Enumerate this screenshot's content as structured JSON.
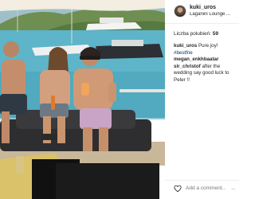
{
  "post": {
    "username": "kuki_uros",
    "location": "Laganini Lounge ...",
    "likes_label": "Liczba polubień:",
    "likes_count": "59",
    "comments": [
      {
        "author": "kuki_uros",
        "text": "Pure joy!",
        "tag": "#bestfrie"
      },
      {
        "author": "megan_enkhbaatar",
        "text": "",
        "tag": ""
      },
      {
        "author": "sir_christof",
        "text": "after the wedding say good luck to Peter !!",
        "tag": ""
      }
    ],
    "add_comment_placeholder": "Add a comment...",
    "more_options": "..."
  },
  "icons": {
    "heart": "heart-icon",
    "more": "more-options-icon"
  },
  "colors": {
    "text": "#262626",
    "hashtag": "#003569",
    "placeholder": "#999999",
    "divider": "#efefef"
  }
}
